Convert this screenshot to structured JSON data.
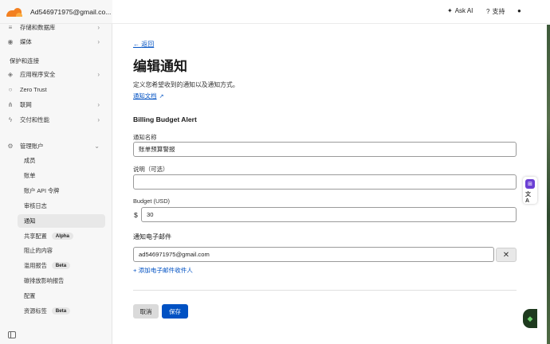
{
  "account": {
    "email": "Ad546971975@gmail.co..."
  },
  "topbar": {
    "ask_ai": "Ask AI",
    "support": "支持"
  },
  "sidebar": {
    "items_top": [
      {
        "label": "存储和数据库"
      },
      {
        "label": "媒体"
      }
    ],
    "section_protect": "保护和连接",
    "items_protect": [
      {
        "label": "应用程序安全"
      },
      {
        "label": "Zero Trust"
      },
      {
        "label": "联网"
      },
      {
        "label": "交付和性能"
      }
    ],
    "manage_account": "管理账户",
    "sub_items": [
      {
        "label": "成员"
      },
      {
        "label": "账单"
      },
      {
        "label": "账户 API 令牌"
      },
      {
        "label": "审核日志"
      },
      {
        "label": "通知"
      },
      {
        "label": "共享配置",
        "badge": "Alpha"
      },
      {
        "label": "阻止的内容"
      },
      {
        "label": "滥用报告",
        "badge": "Beta"
      },
      {
        "label": "碳排放影响报告"
      },
      {
        "label": "配置"
      },
      {
        "label": "资源标签",
        "badge": "Beta"
      }
    ]
  },
  "main": {
    "back": "返回",
    "title": "编辑通知",
    "description": "定义您希望收到的通知以及通知方式。",
    "doc_link": "通知文档",
    "alert_type": "Billing Budget Alert",
    "name_label": "通知名称",
    "name_value": "账单预算警报",
    "desc_label": "说明（可选）",
    "desc_value": "",
    "budget_label": "Budget (USD)",
    "currency_symbol": "$",
    "budget_value": "30",
    "email_section": "通知电子邮件",
    "email_value": "ad546971975@gmail.com",
    "add_recipient": "添加电子邮件收件人",
    "cancel": "取消",
    "save": "保存"
  }
}
